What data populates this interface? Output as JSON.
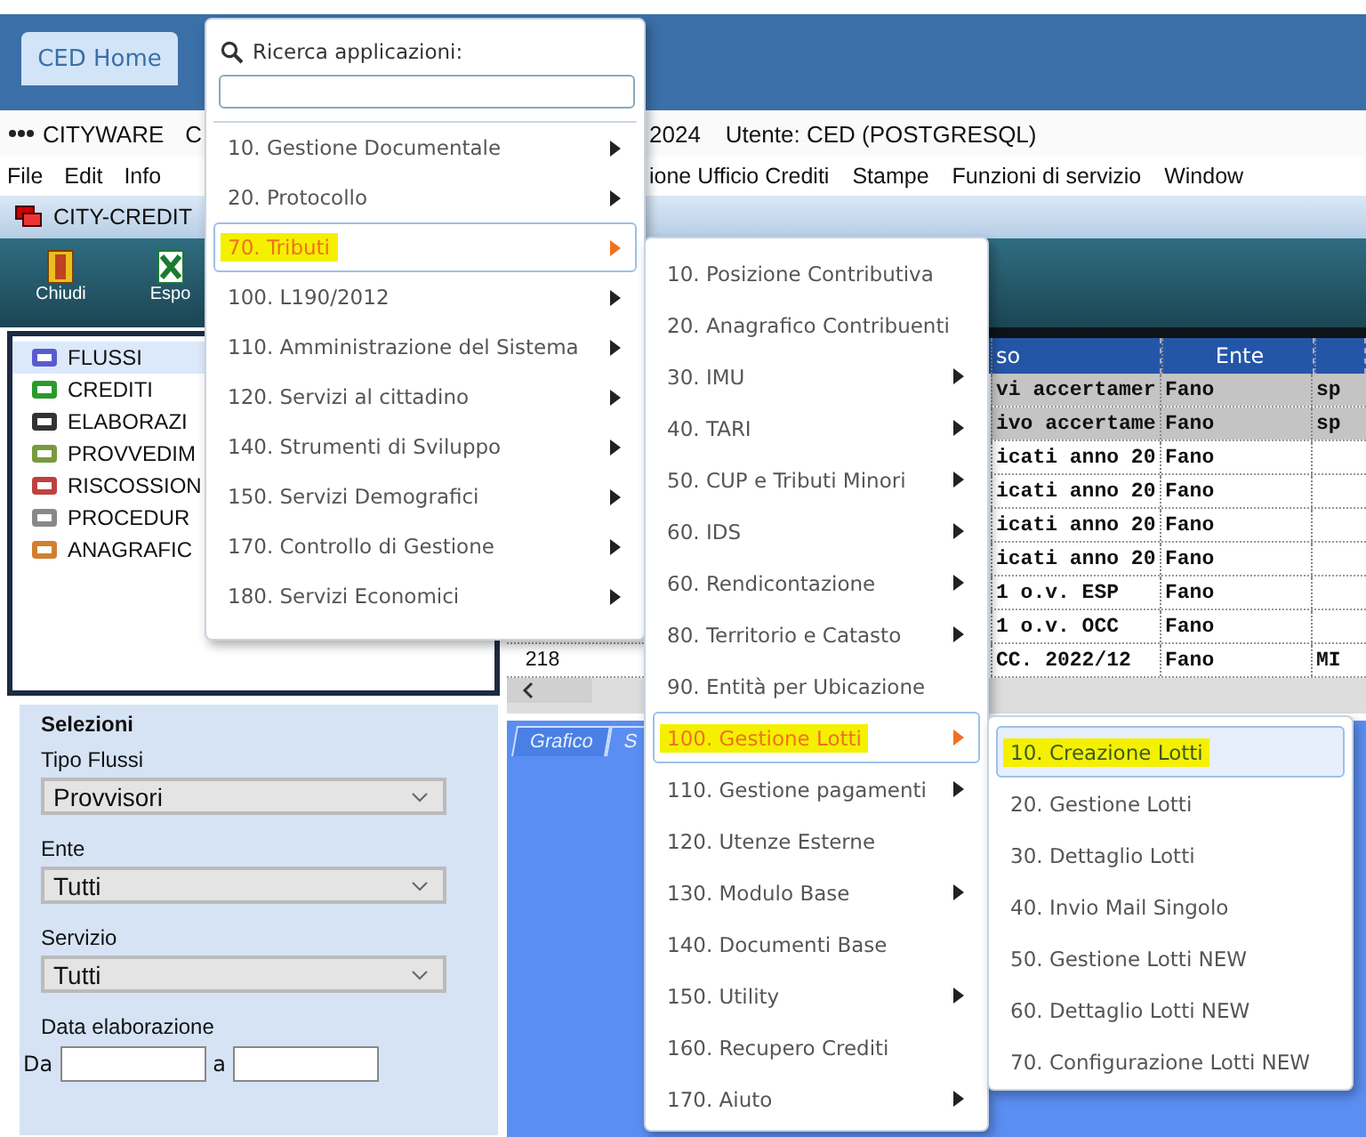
{
  "tabs": [
    {
      "label": "CED Home",
      "selected": true
    }
  ],
  "title_bar": {
    "app": "CITYWARE",
    "cut": "C",
    "info": "2024",
    "user": "Utente: CED (POSTGRESQL)"
  },
  "menu_bar": {
    "left": [
      "File",
      "Edit",
      "Info"
    ],
    "right": [
      "ione Ufficio Crediti",
      "Stampe",
      "Funzioni di servizio",
      "Window"
    ]
  },
  "window": {
    "title": "CITY-CREDIT"
  },
  "toolbar": [
    "Chiudi",
    "Espo"
  ],
  "tree": [
    {
      "label": "FLUSSI",
      "selected": true
    },
    {
      "label": "CREDITI",
      "selected": false
    },
    {
      "label": "ELABORAZI",
      "selected": false
    },
    {
      "label": "PROVVEDIM",
      "selected": false
    },
    {
      "label": "RISCOSSION",
      "selected": false
    },
    {
      "label": "PROCEDUR",
      "selected": false
    },
    {
      "label": "ANAGRAFIC",
      "selected": false
    }
  ],
  "grid": {
    "columns": [
      "so",
      "Ente"
    ],
    "rows": [
      {
        "cells": [
          "vi accertamer",
          "Fano",
          "sp"
        ],
        "selected": true
      },
      {
        "cells": [
          "ivo accertame",
          "Fano",
          "sp"
        ],
        "selected": true
      },
      {
        "cells": [
          "icati anno 20",
          "Fano",
          ""
        ],
        "selected": false
      },
      {
        "cells": [
          "icati anno 20",
          "Fano",
          ""
        ],
        "selected": false
      },
      {
        "cells": [
          "icati anno 20",
          "Fano",
          ""
        ],
        "selected": false
      },
      {
        "cells": [
          "icati anno 20",
          "Fano",
          ""
        ],
        "selected": false
      },
      {
        "cells": [
          "1 o.v. ESP",
          "Fano",
          ""
        ],
        "selected": false
      },
      {
        "cells": [
          "1 o.v. OCC",
          "Fano",
          ""
        ],
        "selected": false
      },
      {
        "number": "218",
        "cells": [
          "CC. 2022/12",
          "Fano",
          "MI"
        ],
        "selected": false
      }
    ]
  },
  "selections": {
    "title": "Selezioni",
    "fields": [
      {
        "label": "Tipo Flussi",
        "value": "Provvisori"
      },
      {
        "label": "Ente",
        "value": "Tutti"
      },
      {
        "label": "Servizio",
        "value": "Tutti"
      }
    ],
    "date_label": "Data elaborazione",
    "from": "Da",
    "to": "a"
  },
  "chart_tabs": [
    {
      "label": "Grafico",
      "selected": true
    },
    {
      "label": "S",
      "selected": false
    }
  ],
  "app_menu": {
    "search_label": "Ricerca applicazioni:",
    "items": [
      {
        "label": "10. Gestione Documentale",
        "submenu": true,
        "selected": false
      },
      {
        "label": "20. Protocollo",
        "submenu": true,
        "selected": false
      },
      {
        "label": "70. Tributi",
        "submenu": true,
        "selected": true
      },
      {
        "label": "100. L190/2012",
        "submenu": true,
        "selected": false
      },
      {
        "label": "110. Amministrazione del Sistema",
        "submenu": true,
        "selected": false
      },
      {
        "label": "120. Servizi al cittadino",
        "submenu": true,
        "selected": false
      },
      {
        "label": "140. Strumenti di Sviluppo",
        "submenu": true,
        "selected": false
      },
      {
        "label": "150. Servizi Demografici",
        "submenu": true,
        "selected": false
      },
      {
        "label": "170. Controllo di Gestione",
        "submenu": true,
        "selected": false
      },
      {
        "label": "180. Servizi Economici",
        "submenu": true,
        "selected": false
      }
    ]
  },
  "tributi_menu": {
    "items": [
      {
        "label": "10. Posizione Contributiva",
        "submenu": false,
        "selected": false
      },
      {
        "label": "20. Anagrafico Contribuenti",
        "submenu": false,
        "selected": false
      },
      {
        "label": "30. IMU",
        "submenu": true,
        "selected": false
      },
      {
        "label": "40. TARI",
        "submenu": true,
        "selected": false
      },
      {
        "label": "50. CUP e Tributi Minori",
        "submenu": true,
        "selected": false
      },
      {
        "label": "60. IDS",
        "submenu": true,
        "selected": false
      },
      {
        "label": "60. Rendicontazione",
        "submenu": true,
        "selected": false
      },
      {
        "label": "80. Territorio e Catasto",
        "submenu": true,
        "selected": false
      },
      {
        "label": "90. Entità per Ubicazione",
        "submenu": false,
        "selected": false
      },
      {
        "label": "100. Gestione Lotti",
        "submenu": true,
        "selected": true
      },
      {
        "label": "110. Gestione pagamenti",
        "submenu": true,
        "selected": false
      },
      {
        "label": "120. Utenze Esterne",
        "submenu": false,
        "selected": false
      },
      {
        "label": "130. Modulo Base",
        "submenu": true,
        "selected": false
      },
      {
        "label": "140. Documenti Base",
        "submenu": false,
        "selected": false
      },
      {
        "label": "150. Utility",
        "submenu": true,
        "selected": false
      },
      {
        "label": "160. Recupero Crediti",
        "submenu": false,
        "selected": false
      },
      {
        "label": "170. Aiuto",
        "submenu": true,
        "selected": false
      }
    ]
  },
  "lotti_menu": {
    "items": [
      {
        "label": "10. Creazione Lotti",
        "submenu": false,
        "selected": true
      },
      {
        "label": "20. Gestione Lotti",
        "submenu": false,
        "selected": false
      },
      {
        "label": "30. Dettaglio Lotti",
        "submenu": false,
        "selected": false
      },
      {
        "label": "40. Invio Mail Singolo",
        "submenu": false,
        "selected": false
      },
      {
        "label": "50. Gestione Lotti NEW",
        "submenu": false,
        "selected": false
      },
      {
        "label": "60. Dettaglio Lotti NEW",
        "submenu": false,
        "selected": false
      },
      {
        "label": "70. Configurazione Lotti NEW",
        "submenu": false,
        "selected": false
      }
    ]
  }
}
